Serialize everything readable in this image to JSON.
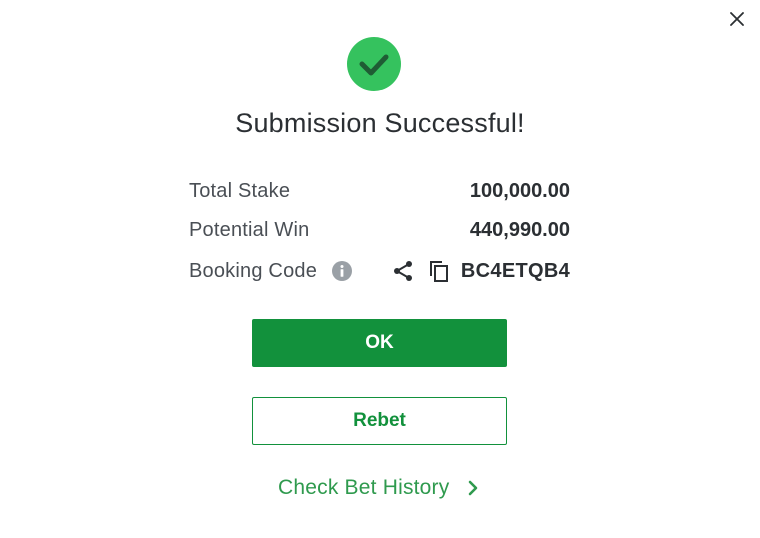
{
  "dialog": {
    "title": "Submission Successful!"
  },
  "details": {
    "total_stake_label": "Total Stake",
    "total_stake_value": "100,000.00",
    "potential_win_label": "Potential Win",
    "potential_win_value": "440,990.00",
    "booking_code_label": "Booking Code",
    "booking_code_value": "BC4ETQB4"
  },
  "actions": {
    "ok_label": "OK",
    "rebet_label": "Rebet",
    "history_label": "Check Bet History"
  },
  "icons": {
    "close": "close-icon",
    "success": "check-circle-icon",
    "info": "info-icon",
    "share": "share-icon",
    "copy": "copy-icon",
    "chevron": "chevron-right-icon"
  },
  "colors": {
    "brand_green": "#12913c",
    "success_green": "#35c25e",
    "link_green": "#2f9a4e",
    "text_dark": "#2b2f33",
    "text_label": "#4a4f55",
    "info_gray": "#9aa0a6"
  }
}
